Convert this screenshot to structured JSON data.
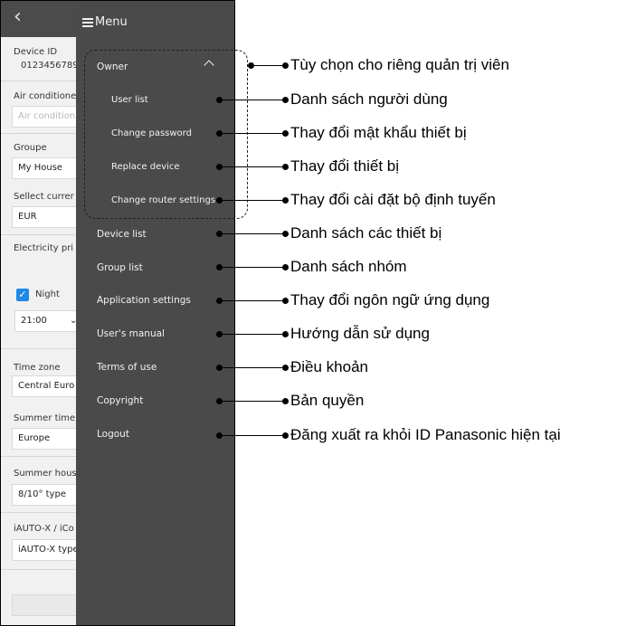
{
  "background": {
    "back_icon": "chevron-left-icon",
    "device_id_label": "Device ID",
    "device_id_value": "0123456789",
    "air_conditioner_label": "Air conditione",
    "air_conditioner_placeholder": "Air condition",
    "groupe_label": "Groupe",
    "groupe_value": "My House",
    "currency_label": "Sellect currer",
    "currency_value": "EUR",
    "electricity_label": "Electricity pri",
    "night_label": "Night",
    "night_time": "21:00",
    "timezone_label": "Time zone",
    "timezone_value": "Central Euro",
    "summer_time_label": "Summer time",
    "summer_time_value": "Europe",
    "summer_house_label": "Summer hous",
    "summer_house_value": "8/10° type",
    "iauto_label": "iAUTO-X / iCo",
    "iauto_value": "iAUTO-X type"
  },
  "menu": {
    "title": "Menu",
    "owner": "Owner",
    "owner_items": [
      "User list",
      "Change password",
      "Replace device",
      "Change router settings"
    ],
    "items": [
      "Device list",
      "Group list",
      "Application settings",
      "User's manual",
      "Terms of use",
      "Copyright",
      "Logout"
    ]
  },
  "annotations": [
    "Tùy chọn cho riêng quản trị viên",
    "Danh sách người dùng",
    "Thay đổi mật khẩu thiết bị",
    "Thay đổi thiết bị",
    "Thay đổi cài đặt bộ định tuyến",
    "Danh sách các thiết bị",
    "Danh sách nhóm",
    "Thay đổi ngôn ngữ ứng dụng",
    "Hướng dẫn sử dụng",
    "Điều khoản",
    "Bản quyền",
    "Đăng xuất ra khỏi ID Panasonic hiện tại"
  ]
}
